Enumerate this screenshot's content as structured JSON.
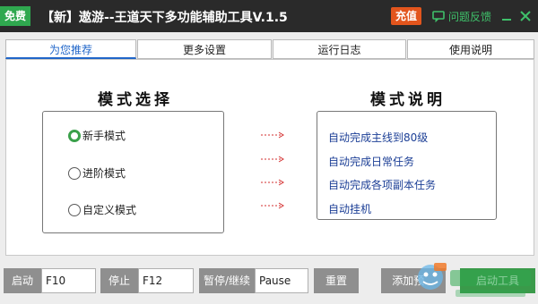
{
  "titlebar": {
    "free_badge": "免费",
    "title": "【新】遨游--王道天下多功能辅助工具V.1.5",
    "recharge": "充值",
    "feedback": "问题反馈",
    "minimize_icon": "minimize-icon",
    "close_icon": "close-icon"
  },
  "tabs": [
    {
      "label": "为您推荐",
      "active": true
    },
    {
      "label": "更多设置",
      "active": false
    },
    {
      "label": "运行日志",
      "active": false
    },
    {
      "label": "使用说明",
      "active": false
    }
  ],
  "main": {
    "mode_select_title": "模式选择",
    "mode_desc_title": "模式说明",
    "modes": [
      {
        "label": "新手模式",
        "checked": true
      },
      {
        "label": "进阶模式",
        "checked": false
      },
      {
        "label": "自定义模式",
        "checked": false
      }
    ],
    "descriptions": [
      "自动完成主线到80级",
      "自动完成日常任务",
      "自动完成各项副本任务",
      "自动挂机"
    ]
  },
  "bottom": {
    "start_label": "启动",
    "start_key": "F10",
    "stop_label": "停止",
    "stop_key": "F12",
    "pause_label": "暂停/继续",
    "pause_key": "Pause",
    "reset": "重置",
    "add": "添加预...",
    "start_tool": "启动工具"
  },
  "colors": {
    "titlebar_bg": "#2a2a2a",
    "free_green": "#2fa84f",
    "recharge_orange": "#e2551d",
    "accent_blue": "#2066c9",
    "desc_blue": "#1c3f96",
    "arrow_red": "#d32f2f",
    "button_gray": "#8f8f8f"
  }
}
